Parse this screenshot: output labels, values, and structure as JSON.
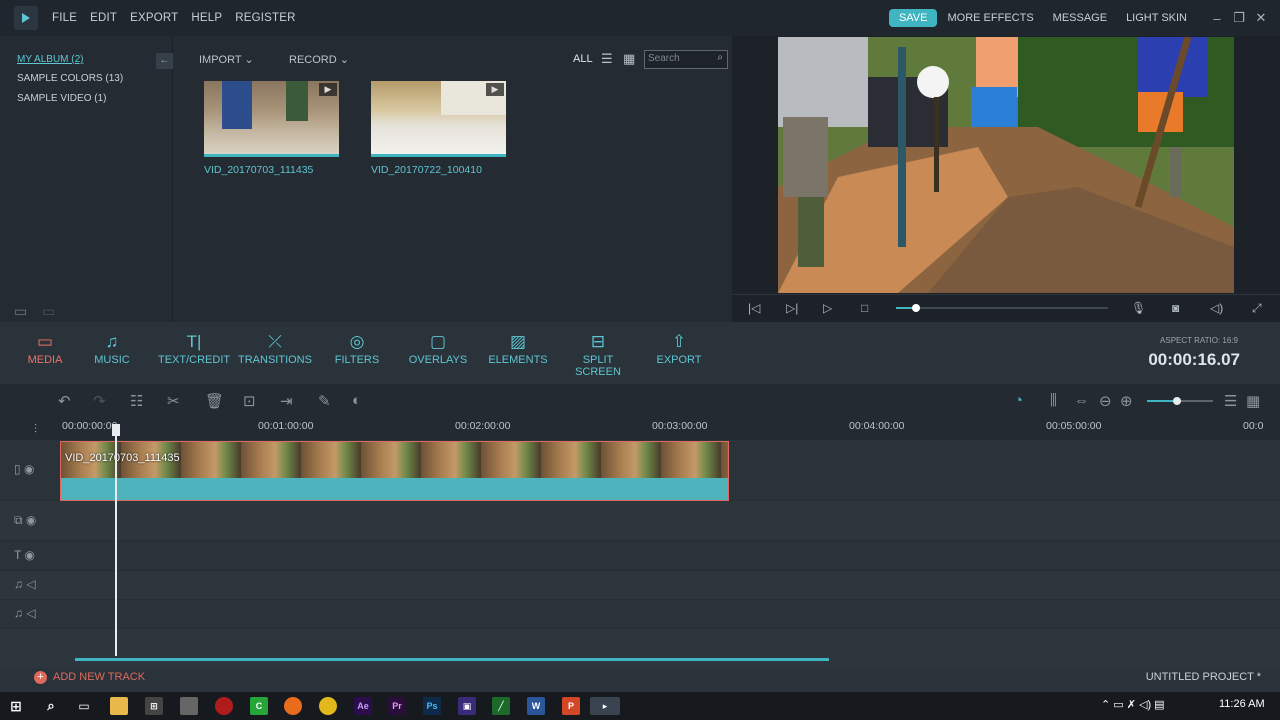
{
  "menu": [
    "FILE",
    "EDIT",
    "EXPORT",
    "HELP",
    "REGISTER"
  ],
  "topright": {
    "save": "SAVE",
    "more_effects": "MORE EFFECTS",
    "message": "MESSAGE",
    "light_skin": "LIGHT SKIN"
  },
  "albums": [
    {
      "label": "MY ALBUM (2)",
      "active": true
    },
    {
      "label": "SAMPLE COLORS (13)",
      "active": false
    },
    {
      "label": "SAMPLE VIDEO (1)",
      "active": false
    }
  ],
  "library": {
    "import": "IMPORT",
    "record": "RECORD",
    "all": "ALL",
    "search_placeholder": "Search",
    "media": [
      {
        "name": "VID_20170703_111435"
      },
      {
        "name": "VID_20170722_100410"
      }
    ]
  },
  "modules": [
    {
      "label": "MEDIA",
      "icon": "folder-icon",
      "active": true
    },
    {
      "label": "MUSIC",
      "icon": "music-note-icon",
      "active": false
    },
    {
      "label": "TEXT/CREDIT",
      "icon": "text-icon",
      "active": false
    },
    {
      "label": "TRANSITIONS",
      "icon": "transition-icon",
      "active": false
    },
    {
      "label": "FILTERS",
      "icon": "filter-icon",
      "active": false
    },
    {
      "label": "OVERLAYS",
      "icon": "overlay-icon",
      "active": false
    },
    {
      "label": "ELEMENTS",
      "icon": "image-icon",
      "active": false
    },
    {
      "label": "SPLIT SCREEN",
      "icon": "split-screen-icon",
      "active": false
    },
    {
      "label": "EXPORT",
      "icon": "export-icon",
      "active": false
    }
  ],
  "aspect_ratio": "ASPECT RATIO: 16:9",
  "timecode": "00:00:16.07",
  "ruler": [
    "00:00:00:00",
    "00:01:00:00",
    "00:02:00:00",
    "00:03:00:00",
    "00:04:00:00",
    "00:05:00:00",
    "00:0"
  ],
  "clip": {
    "title": "VID_20170703_111435"
  },
  "bottom": {
    "add_track": "ADD NEW TRACK",
    "project": "UNTITLED PROJECT *"
  },
  "taskbar": {
    "time": "11:26 AM"
  },
  "colors": {
    "accent": "#3fb5c2",
    "active": "#f07363"
  }
}
